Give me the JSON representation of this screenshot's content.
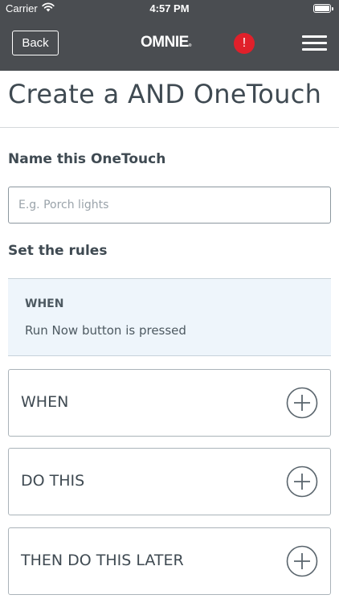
{
  "status_bar": {
    "carrier": "Carrier",
    "time": "4:57 PM"
  },
  "nav": {
    "back_label": "Back",
    "logo": "OMNIE",
    "logo_mark": "®",
    "alert_symbol": "!",
    "alert_color": "#e0202a"
  },
  "page": {
    "title": "Create a AND OneTouch"
  },
  "name_section": {
    "label": "Name this OneTouch",
    "input_value": "",
    "input_placeholder": "E.g. Porch lights"
  },
  "rules_section": {
    "label": "Set the rules",
    "existing_rule": {
      "heading": "WHEN",
      "description": "Run Now button is pressed"
    },
    "cards": [
      {
        "label": "WHEN",
        "icon": "plus-circle-icon"
      },
      {
        "label": "DO THIS",
        "icon": "plus-circle-icon"
      },
      {
        "label": "THEN DO THIS LATER",
        "icon": "plus-circle-icon"
      }
    ]
  },
  "colors": {
    "header_bg": "#4a4d51",
    "text": "#3f4a52",
    "summary_bg": "#eef5fb"
  }
}
